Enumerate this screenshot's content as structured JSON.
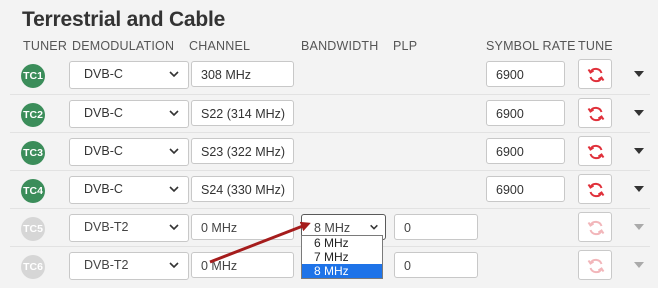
{
  "title": "Terrestrial and Cable",
  "headers": {
    "tuner": "TUNER",
    "demodulation": "DEMODULATION",
    "channel": "CHANNEL",
    "bandwidth": "BANDWIDTH",
    "plp": "PLP",
    "symbol_rate": "SYMBOL RATE",
    "tune": "TUNE"
  },
  "rows": [
    {
      "tuner": "TC1",
      "demodulation": "DVB-C",
      "channel": "308 MHz",
      "symbol_rate": "6900"
    },
    {
      "tuner": "TC2",
      "demodulation": "DVB-C",
      "channel": "S22 (314 MHz)",
      "symbol_rate": "6900"
    },
    {
      "tuner": "TC3",
      "demodulation": "DVB-C",
      "channel": "S23 (322 MHz)",
      "symbol_rate": "6900"
    },
    {
      "tuner": "TC4",
      "demodulation": "DVB-C",
      "channel": "S24 (330 MHz)",
      "symbol_rate": "6900"
    },
    {
      "tuner": "TC5",
      "demodulation": "DVB-T2",
      "channel": "0 MHz",
      "bandwidth": "8 MHz",
      "plp": "0"
    },
    {
      "tuner": "TC6",
      "demodulation": "DVB-T2",
      "channel": "0 MHz",
      "plp": "0"
    }
  ],
  "bandwidth_options": [
    "6 MHz",
    "7 MHz",
    "8 MHz"
  ],
  "bandwidth_selected": "8 MHz",
  "colors": {
    "tuner_active": "#3b8d5a",
    "tuner_inactive": "#d6d6d6",
    "tune_icon_active": "#e0303a",
    "tune_icon_inactive": "#f2b6ba",
    "annotation_arrow": "#a51c1c",
    "option_highlight": "#1e73e8"
  },
  "icons": {
    "tune": "refresh-icon",
    "row_expand": "caret-down-icon",
    "select": "chevron-down-icon"
  }
}
